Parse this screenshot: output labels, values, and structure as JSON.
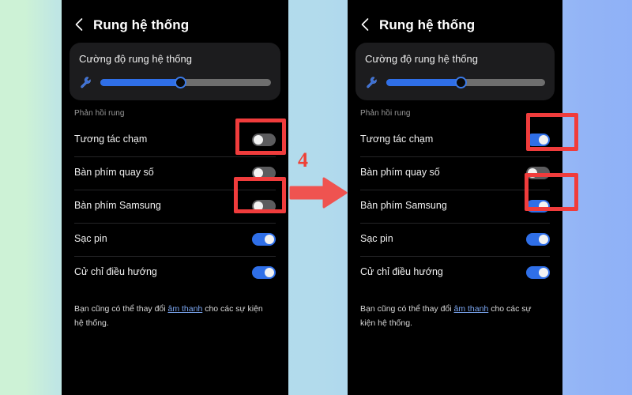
{
  "background": {
    "gradient_left": "#cdf2d6",
    "gradient_mid": "#b2dbec",
    "gradient_right": "#8fb1f7"
  },
  "annotation": {
    "step_number": "4",
    "arrow_color": "#ef4035",
    "highlight_color": "#f03c3c"
  },
  "icons": {
    "back": "chevron-left-icon",
    "slider_lead": "wrench-icon"
  },
  "panels": [
    {
      "id": "before",
      "header": {
        "title": "Rung hệ thống",
        "back_label": "Quay lại"
      },
      "card": {
        "title": "Cường độ rung hệ thống",
        "slider": {
          "value_percent": 47,
          "min": 0,
          "max": 100
        }
      },
      "section_label": "Phản hồi rung",
      "rows": [
        {
          "label": "Tương tác chạm",
          "state": "off",
          "highlighted": true
        },
        {
          "label": "Bàn phím quay số",
          "state": "off",
          "highlighted": false
        },
        {
          "label": "Bàn phím Samsung",
          "state": "off",
          "highlighted": true
        },
        {
          "label": "Sạc pin",
          "state": "on",
          "highlighted": false
        },
        {
          "label": "Cử chỉ điều hướng",
          "state": "on",
          "highlighted": false
        }
      ],
      "footer": {
        "text_before": "Bạn cũng có thể thay đổi ",
        "link": "âm thanh",
        "text_after": " cho các sự kiện hệ thống."
      }
    },
    {
      "id": "after",
      "header": {
        "title": "Rung hệ thống",
        "back_label": "Quay lại"
      },
      "card": {
        "title": "Cường độ rung hệ thống",
        "slider": {
          "value_percent": 47,
          "min": 0,
          "max": 100
        }
      },
      "section_label": "Phản hồi rung",
      "rows": [
        {
          "label": "Tương tác chạm",
          "state": "on",
          "highlighted": true
        },
        {
          "label": "Bàn phím quay số",
          "state": "off",
          "highlighted": false
        },
        {
          "label": "Bàn phím Samsung",
          "state": "on",
          "highlighted": true
        },
        {
          "label": "Sạc pin",
          "state": "on",
          "highlighted": false
        },
        {
          "label": "Cử chỉ điều hướng",
          "state": "on",
          "highlighted": false
        }
      ],
      "footer": {
        "text_before": "Bạn cũng có thể thay đổi ",
        "link": "âm thanh",
        "text_after": " cho các sự kiện hệ thống."
      }
    }
  ]
}
